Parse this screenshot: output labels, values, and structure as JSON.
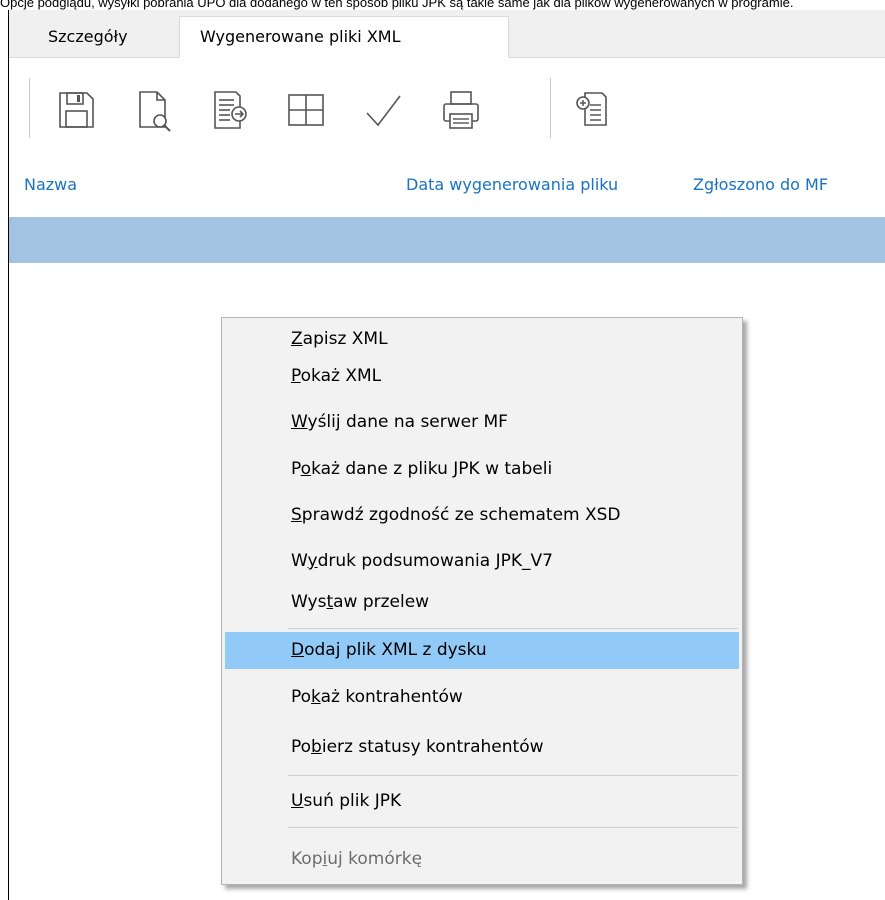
{
  "caption": "Opcje podglądu, wysyłki pobrania UPO dla dodanego w ten sposób pliku JPK są takie same jak dla plików wygenerowanych w programie.",
  "tabs": [
    {
      "label": "Szczegóły",
      "active": false
    },
    {
      "label": "Wygenerowane pliki XML",
      "active": true
    }
  ],
  "toolbar_icons": [
    "save-icon",
    "preview-icon",
    "export-icon",
    "table-icon",
    "checkmark-icon",
    "print-icon",
    "add-file-icon"
  ],
  "columns": {
    "name": "Nazwa",
    "generated_date": "Data wygenerowania pliku",
    "reported": "Zgłoszono do MF"
  },
  "menu": {
    "items": [
      {
        "pre": "",
        "u": "Z",
        "post": "apisz XML",
        "state": "normal"
      },
      {
        "pre": "",
        "u": "P",
        "post": "okaż XML",
        "state": "normal"
      },
      {
        "pre": "",
        "u": "W",
        "post": "yślij dane na serwer MF",
        "state": "normal"
      },
      {
        "pre": "P",
        "u": "o",
        "post": "każ dane z pliku JPK w tabeli",
        "state": "normal"
      },
      {
        "pre": "",
        "u": "S",
        "post": "prawdź zgodność ze schematem XSD",
        "state": "normal"
      },
      {
        "pre": "W",
        "u": "y",
        "post": "druk podsumowania JPK_V7",
        "state": "normal"
      },
      {
        "pre": "Wys",
        "u": "t",
        "post": "aw przelew",
        "state": "normal"
      },
      {
        "pre": "",
        "u": "D",
        "post": "odaj plik XML z dysku",
        "state": "highlighted"
      },
      {
        "pre": "Po",
        "u": "k",
        "post": "aż kontrahentów",
        "state": "normal"
      },
      {
        "pre": "Po",
        "u": "b",
        "post": "ierz statusy kontrahentów",
        "state": "normal"
      },
      {
        "pre": "",
        "u": "U",
        "post": "suń plik JPK",
        "state": "normal"
      },
      {
        "pre": "Kop",
        "u": "i",
        "post": "uj komórkę",
        "state": "disabled"
      }
    ]
  },
  "colors": {
    "tab_bar": "#f0f0f0",
    "header_text": "#1a73c2",
    "selected_row": "#a0c4e2",
    "menu_bg": "#f2f2f2",
    "menu_highlight": "#91c9f7",
    "disabled_text": "#6d6d6d"
  }
}
